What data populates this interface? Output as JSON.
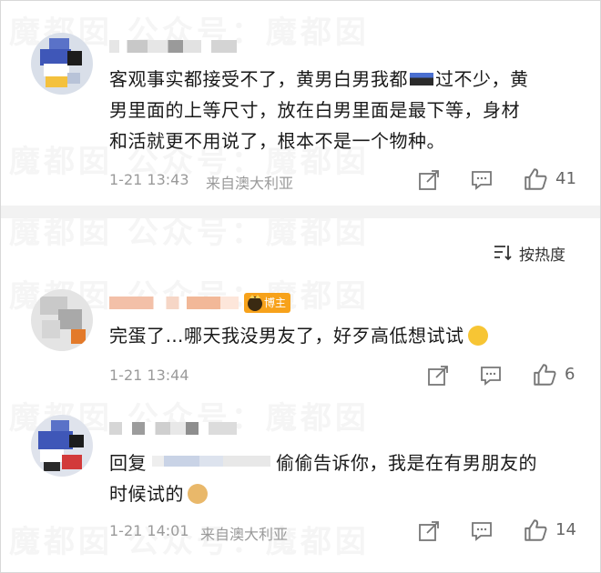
{
  "watermark": {
    "text": "魔都囡  公众号：魔都囡"
  },
  "sort": {
    "label": "按热度"
  },
  "comments": [
    {
      "text": "客观事实都接受不了，黄男白男我都 过不少，黄男里面的上等尺寸，放在白男里面是最下等，身材和活就更不用说了，根本不是一个物种。",
      "lines": [
        "客观事实都接受不了，黄男白男我都",
        "过不少，黄",
        "男里面的上等尺寸，放在白男里面是最下等，身材",
        "和活就更不用说了，根本不是一个物种。"
      ],
      "time": "1-21 13:43",
      "source": "来自澳大利亚",
      "likes": "41"
    },
    {
      "badge": "博主",
      "text": "完蛋了…哪天我没男友了，好歹高低想试试",
      "time": "1-21 13:44",
      "source": "",
      "likes": "6"
    },
    {
      "reply_prefix": "回复",
      "text_after_mention": "偷偷告诉你，我是在有男朋友的",
      "text_line2": "时候试的",
      "time": "1-21 14:01",
      "source": "来自澳大利亚",
      "likes": "14"
    }
  ],
  "icons": [
    "share-icon",
    "comment-icon",
    "like-icon",
    "sort-icon"
  ],
  "colors": {
    "badge": "#f7a21b",
    "meta": "#9a9a9a",
    "divider": "#f2f2f2"
  }
}
